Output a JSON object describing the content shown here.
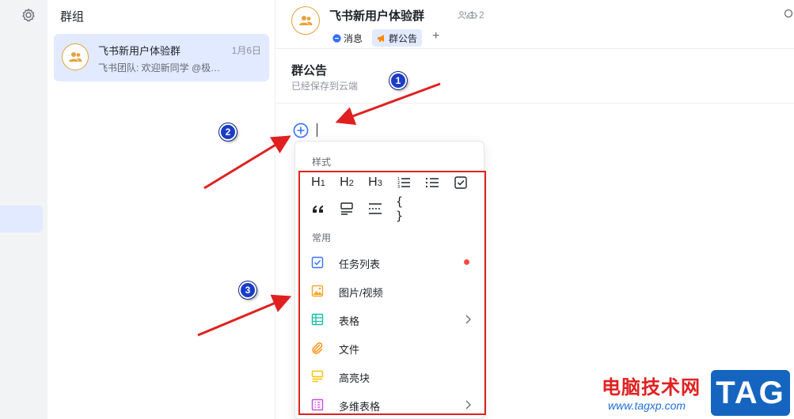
{
  "sidebar": {
    "settings_icon": "gear-icon"
  },
  "group_list": {
    "title": "群组",
    "chats": [
      {
        "name": "飞书新用户体验群",
        "date": "1月6日",
        "preview": "飞书团队: 欢迎新同学 @极…",
        "avatar_icon": "group-icon"
      }
    ]
  },
  "header": {
    "group_name": "飞书新用户体验群",
    "member_count": "1",
    "bot_count": "2",
    "tabs": [
      {
        "label": "消息",
        "icon": "chat-bubble-icon"
      },
      {
        "label": "群公告",
        "icon": "megaphone-icon",
        "active": true
      }
    ],
    "add_tab": "+"
  },
  "announcement": {
    "title": "群公告",
    "status": "已经保存到云端"
  },
  "insert_menu": {
    "style_section": "样式",
    "styles": [
      {
        "label": "H1",
        "icon": "heading-1-icon"
      },
      {
        "label": "H2",
        "icon": "heading-2-icon"
      },
      {
        "label": "H3",
        "icon": "heading-3-icon"
      },
      {
        "icon": "ordered-list-icon"
      },
      {
        "icon": "bullet-list-icon"
      },
      {
        "icon": "checkbox-icon"
      },
      {
        "icon": "quote-icon"
      },
      {
        "icon": "callout-text-icon"
      },
      {
        "icon": "divider-icon"
      },
      {
        "label": "{ }",
        "icon": "code-block-icon"
      }
    ],
    "common_section": "常用",
    "items": [
      {
        "label": "任务列表",
        "icon": "task-list-icon",
        "color": "#3370ff",
        "badge": true
      },
      {
        "label": "图片/视频",
        "icon": "image-icon",
        "color": "#f5a623"
      },
      {
        "label": "表格",
        "icon": "table-icon",
        "color": "#14c0a5",
        "submenu": true
      },
      {
        "label": "文件",
        "icon": "paperclip-icon",
        "color": "#ff8800"
      },
      {
        "label": "高亮块",
        "icon": "highlight-block-icon",
        "color": "#f5c400"
      },
      {
        "label": "多维表格",
        "icon": "bitable-icon",
        "color": "#c94de0",
        "submenu": true
      }
    ]
  },
  "annotations": {
    "badges": [
      "1",
      "2",
      "3"
    ],
    "highlight_color": "#e02020"
  },
  "watermark": {
    "site_name": "电脑技术网",
    "url": "www.tagxp.com",
    "tag": "TAG"
  },
  "colors": {
    "accent": "#3370ff",
    "active_bg": "#e1eaff",
    "avatar_ring": "#e6a23c"
  }
}
